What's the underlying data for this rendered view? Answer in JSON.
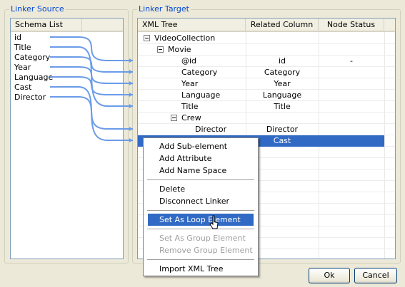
{
  "linker_source": {
    "title": "Linker Source",
    "header": "Schema List",
    "items": [
      "id",
      "Title",
      "Category",
      "Year",
      "Language",
      "Cast",
      "Director"
    ]
  },
  "linker_target": {
    "title": "Linker Target",
    "columns": [
      "XML Tree",
      "Related Column",
      "Node Status"
    ],
    "rows": [
      {
        "label": "VideoCollection",
        "related": "",
        "status": "",
        "expander": true
      },
      {
        "label": "Movie",
        "related": "",
        "status": "",
        "expander": true
      },
      {
        "label": "@id",
        "related": "id",
        "status": "-",
        "expander": false
      },
      {
        "label": "Category",
        "related": "Category",
        "status": "",
        "expander": false
      },
      {
        "label": "Year",
        "related": "Year",
        "status": "",
        "expander": false
      },
      {
        "label": "Language",
        "related": "Language",
        "status": "",
        "expander": false
      },
      {
        "label": "Title",
        "related": "Title",
        "status": "",
        "expander": false
      },
      {
        "label": "Crew",
        "related": "",
        "status": "",
        "expander": true
      },
      {
        "label": "Director",
        "related": "Director",
        "status": "",
        "expander": false
      },
      {
        "label": "",
        "related": "Cast",
        "status": "",
        "expander": false,
        "selected": true
      }
    ]
  },
  "context_menu": {
    "items": [
      {
        "label": "Add Sub-element",
        "state": "normal"
      },
      {
        "label": "Add Attribute",
        "state": "normal"
      },
      {
        "label": "Add Name Space",
        "state": "normal"
      },
      {
        "label": "Delete",
        "state": "normal"
      },
      {
        "label": "Disconnect Linker",
        "state": "normal"
      },
      {
        "label": "Set As Loop Element",
        "state": "highlighted"
      },
      {
        "label": "Set As Group Element",
        "state": "disabled"
      },
      {
        "label": "Remove Group Element",
        "state": "disabled"
      },
      {
        "label": "Import XML Tree",
        "state": "normal"
      }
    ]
  },
  "buttons": {
    "ok": "Ok",
    "cancel": "Cancel"
  },
  "colors": {
    "accent": "#316ac5",
    "link_line": "#6a9be8",
    "group_title": "#0046d5"
  },
  "links": [
    {
      "source": "id",
      "target": "@id"
    },
    {
      "source": "Title",
      "target": "Title"
    },
    {
      "source": "Category",
      "target": "Category"
    },
    {
      "source": "Year",
      "target": "Year"
    },
    {
      "source": "Language",
      "target": "Language"
    },
    {
      "source": "Cast",
      "target": "Cast"
    },
    {
      "source": "Director",
      "target": "Director"
    }
  ]
}
